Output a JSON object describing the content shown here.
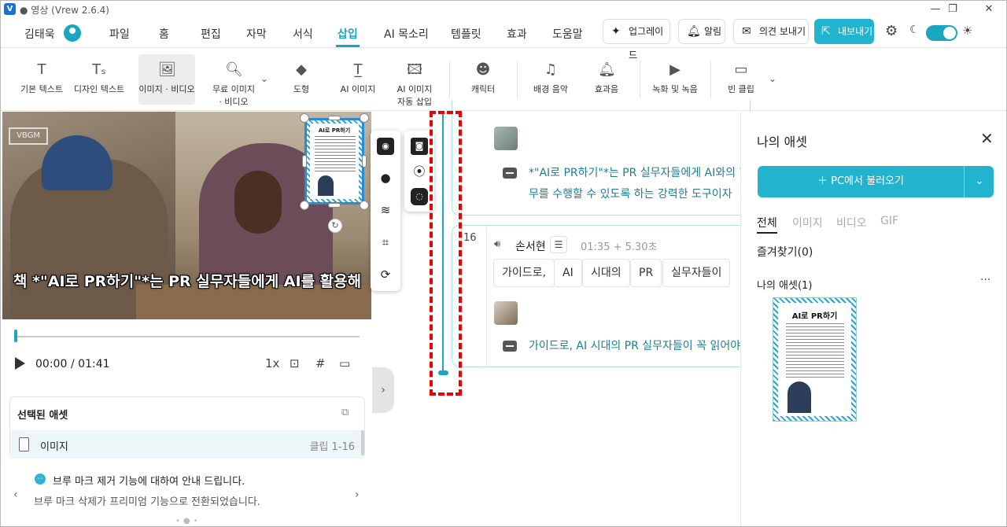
{
  "window": {
    "title": "● 영상 (Vrew 2.6.4)",
    "logo": "V",
    "minimize_icon": "—",
    "restore_icon": "❐",
    "close_icon": "✕"
  },
  "menubar": {
    "user_name": "김태욱",
    "items": [
      "파일",
      "홈",
      "편집",
      "자막",
      "서식",
      "삽입",
      "AI 목소리",
      "템플릿",
      "효과",
      "도움말"
    ],
    "active": "삽입",
    "upgrade_label": "업그레이드",
    "alarm_label": "알림",
    "feedback_label": "의견 보내기",
    "export_label": "내보내기",
    "accent_color": "#1aa5c0"
  },
  "toolbar": {
    "items": [
      {
        "label": "기본 텍스트",
        "icon": "text-icon"
      },
      {
        "label": "디자인 텍스트",
        "icon": "design-text-icon"
      },
      {
        "label": "이미지 · 비디오",
        "icon": "image-video-icon"
      },
      {
        "label_line1": "무료 이미지",
        "label_line2": "· 비디오",
        "icon": "free-image-search-icon"
      },
      {
        "label": "도형",
        "icon": "shapes-icon"
      },
      {
        "label": "AI 이미지",
        "icon": "ai-image-icon"
      },
      {
        "label_line1": "AI 이미지",
        "label_line2": "자동 삽입",
        "icon": "ai-image-auto-icon"
      },
      {
        "label": "캐릭터",
        "icon": "character-icon"
      },
      {
        "label": "배경 음악",
        "icon": "music-icon"
      },
      {
        "label": "효과음",
        "icon": "bell-icon"
      },
      {
        "label": "녹화 및 녹음",
        "icon": "camera-icon"
      },
      {
        "label": "빈 클립",
        "icon": "blank-clip-icon"
      }
    ]
  },
  "preview": {
    "caption": "책 *\"AI로 PR하기\"*는 PR 실무자들에게 AI를 활용해",
    "watermark": "VBGM",
    "overlay_title": "AI로 PR하기",
    "rotate_icon": "↻"
  },
  "player": {
    "current_time": "00:00",
    "total_time": "/ 01:41",
    "speed": "1x",
    "progress": 0.0
  },
  "selected_assets": {
    "title": "선택된 애셋",
    "row_label": "이미지",
    "row_meta": "클립 1-16"
  },
  "notice": {
    "title": "브루 마크 제거 기능에 대하여 안내 드립니다.",
    "subtitle": "브루 마크 삭제가 프리미엄 기능으로 전환되었습니다.",
    "icon": "···"
  },
  "timeline": {
    "clip15_text_line1": "*\"AI로 PR하기\"*는 PR 실무자들에게 AI와의 협",
    "clip15_text_line2": "무를 수행할 수 있도록 하는 강력한 도구이자",
    "clip16_number": "16",
    "clip16_speaker": "손서현",
    "clip16_time": "01:35 + 5.30초",
    "clip16_words": [
      "가이드로,",
      "AI",
      "시대의",
      "PR",
      "실무자들이"
    ],
    "clip16_text": "가이드로, AI 시대의 PR 실무자들이 꼭 읽어야"
  },
  "asset_panel": {
    "title": "나의 애셋",
    "load_label": "＋ PC에서 불러오기",
    "tabs": [
      "전체",
      "이미지",
      "비디오",
      "GIF"
    ],
    "favorites": "즐겨찾기(0)",
    "mine": "나의 애셋(1)",
    "thumb_title": "AI로 PR하기"
  }
}
